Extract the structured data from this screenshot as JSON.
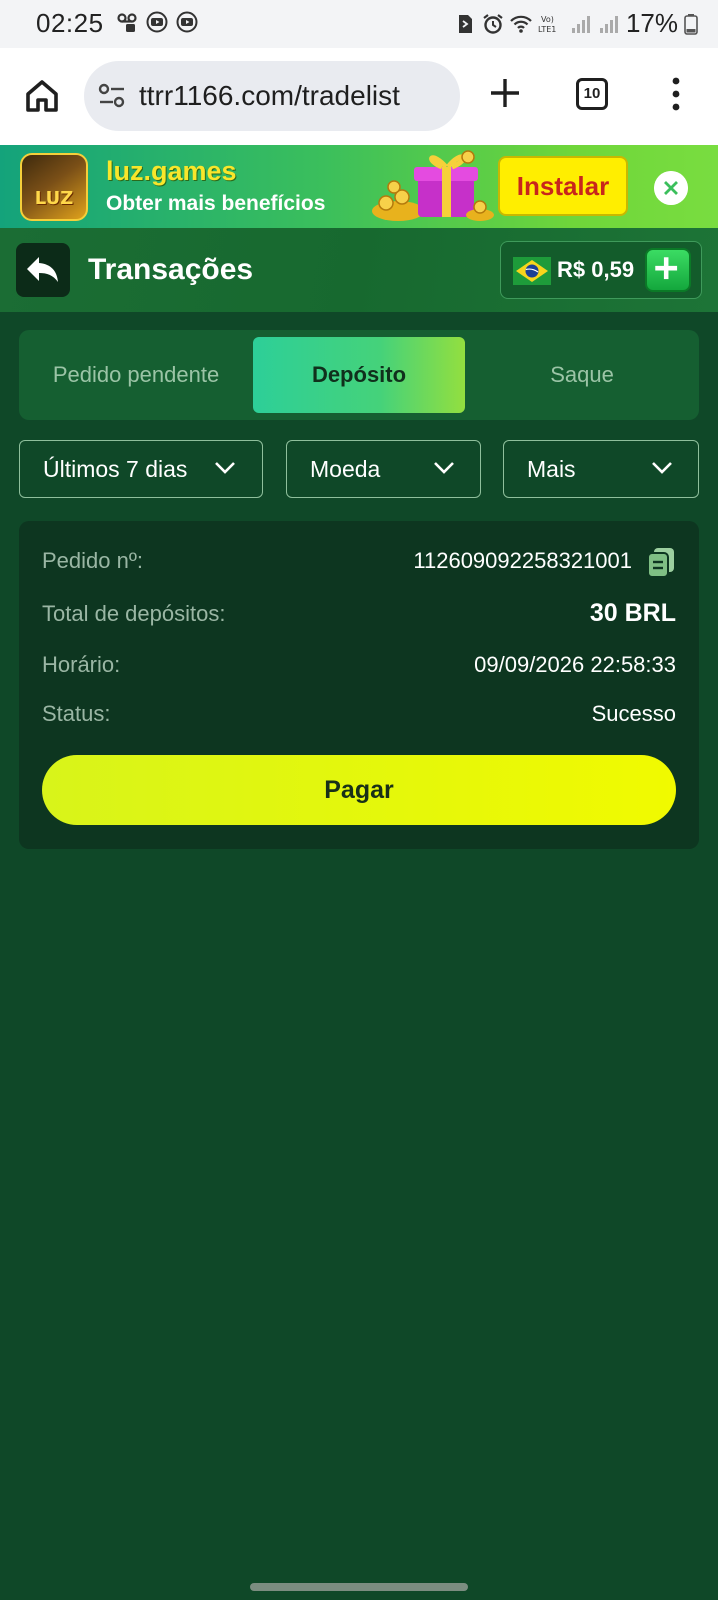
{
  "status_bar": {
    "time": "02:25",
    "battery": "17%",
    "icons": [
      "voicemail-icon",
      "youtube-icon",
      "youtube-icon",
      "sim-icon",
      "alarm-icon",
      "wifi-icon",
      "volte-icon",
      "signal-icon",
      "signal-icon",
      "battery-icon"
    ]
  },
  "browser": {
    "url": "ttrr1166.com/tradelist",
    "tab_count": "10"
  },
  "banner": {
    "logo_text": "LUZ",
    "title": "luz.games",
    "subtitle": "Obter mais benefícios",
    "install_label": "Instalar"
  },
  "header": {
    "title": "Transações",
    "balance": "R$ 0,59"
  },
  "tabs": {
    "pending": "Pedido pendente",
    "deposit": "Depósito",
    "withdraw": "Saque",
    "active": "deposit"
  },
  "filters": {
    "period": "Últimos 7 dias",
    "currency": "Moeda",
    "more": "Mais"
  },
  "transaction": {
    "order_label": "Pedido nº:",
    "order_value": "112609092258321001",
    "total_label": "Total de depósitos:",
    "total_value": "30 BRL",
    "time_label": "Horário:",
    "time_value": "09/09/2026 22:58:33",
    "status_label": "Status:",
    "status_value": "Sucesso",
    "pay_label": "Pagar"
  },
  "colors": {
    "page_bg": "#0f4828",
    "card_bg": "#0d3620",
    "accent_tab": "#45d27a",
    "pay_button": "#e6f809",
    "install_button": "#ffee00"
  }
}
